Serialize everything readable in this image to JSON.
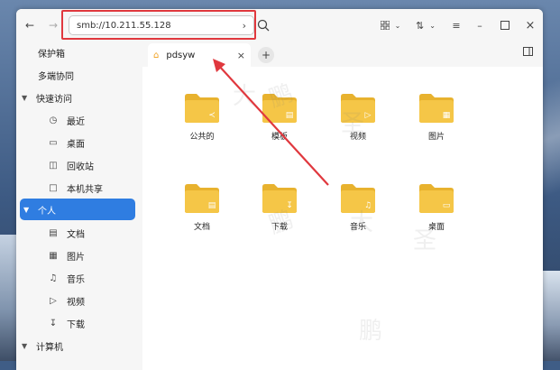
{
  "window": {
    "address": "smb://10.211.55.128",
    "toolbar_icons": {
      "back": "back-arrow-icon",
      "forward": "forward-arrow-icon",
      "go": "chevron-right-icon",
      "search": "search-icon",
      "view": "icon-view-icon",
      "sort": "sort-icon",
      "menu": "hamburger-menu-icon",
      "minimize": "minimize-icon",
      "maximize": "maximize-icon",
      "close": "close-icon"
    }
  },
  "sidebar": {
    "items": [
      {
        "label": "保护箱",
        "icon": ""
      },
      {
        "label": "多端协同",
        "icon": ""
      },
      {
        "label": "快速访问",
        "icon": "chevron-down-icon"
      },
      {
        "label": "最近",
        "icon": "clock-icon"
      },
      {
        "label": "桌面",
        "icon": "desktop-icon"
      },
      {
        "label": "回收站",
        "icon": "trash-icon"
      },
      {
        "label": "本机共享",
        "icon": "folder-share-icon"
      },
      {
        "label": "个人",
        "icon": "chevron-down-icon"
      },
      {
        "label": "文档",
        "icon": "document-icon"
      },
      {
        "label": "图片",
        "icon": "image-icon"
      },
      {
        "label": "音乐",
        "icon": "music-icon"
      },
      {
        "label": "视频",
        "icon": "video-icon"
      },
      {
        "label": "下载",
        "icon": "download-icon"
      },
      {
        "label": "计算机",
        "icon": "chevron-down-icon"
      }
    ],
    "active_index": 7
  },
  "tabs": [
    {
      "label": "pdsyw",
      "icon": "home-icon"
    }
  ],
  "folders": [
    {
      "label": "公共的",
      "icon": "share-badge"
    },
    {
      "label": "模板",
      "icon": "template-badge"
    },
    {
      "label": "视频",
      "icon": "video-badge"
    },
    {
      "label": "图片",
      "icon": "image-badge"
    },
    {
      "label": "文档",
      "icon": "document-badge"
    },
    {
      "label": "下载",
      "icon": "download-badge"
    },
    {
      "label": "音乐",
      "icon": "music-badge"
    },
    {
      "label": "桌面",
      "icon": "desktop-badge"
    }
  ],
  "colors": {
    "accent": "#2f7de1",
    "folder": "#f5c647",
    "folder_dark": "#e8b22e",
    "highlight": "#e0383e"
  },
  "watermark": [
    "大",
    "圣",
    "鹏"
  ]
}
